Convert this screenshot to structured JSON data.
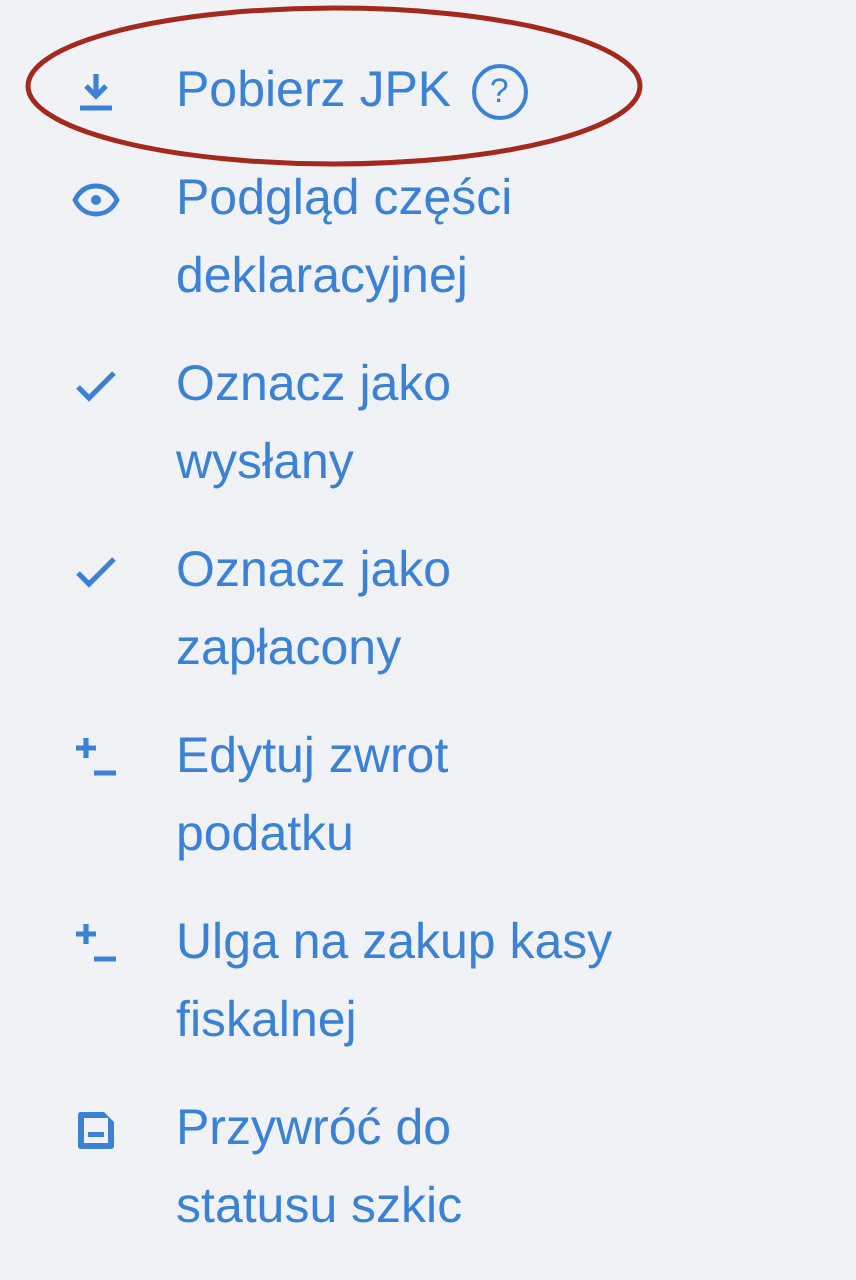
{
  "actions": [
    {
      "kind": "download",
      "label": "Pobierz JPK",
      "help": "?",
      "highlighted": true
    },
    {
      "kind": "preview",
      "label": "Podgląd części\ndeklaracyjnej",
      "highlighted": false
    },
    {
      "kind": "mark",
      "label": "Oznacz jako\nwysłany",
      "highlighted": false
    },
    {
      "kind": "mark",
      "label": "Oznacz jako\nzapłacony",
      "highlighted": false
    },
    {
      "kind": "adjust",
      "label": "Edytuj zwrot\npodatku",
      "highlighted": false
    },
    {
      "kind": "adjust",
      "label": "Ulga na zakup kasy\nfiskalnej",
      "highlighted": false
    },
    {
      "kind": "revert",
      "label": "Przywróć do\nstatusu szkic",
      "highlighted": false
    }
  ]
}
